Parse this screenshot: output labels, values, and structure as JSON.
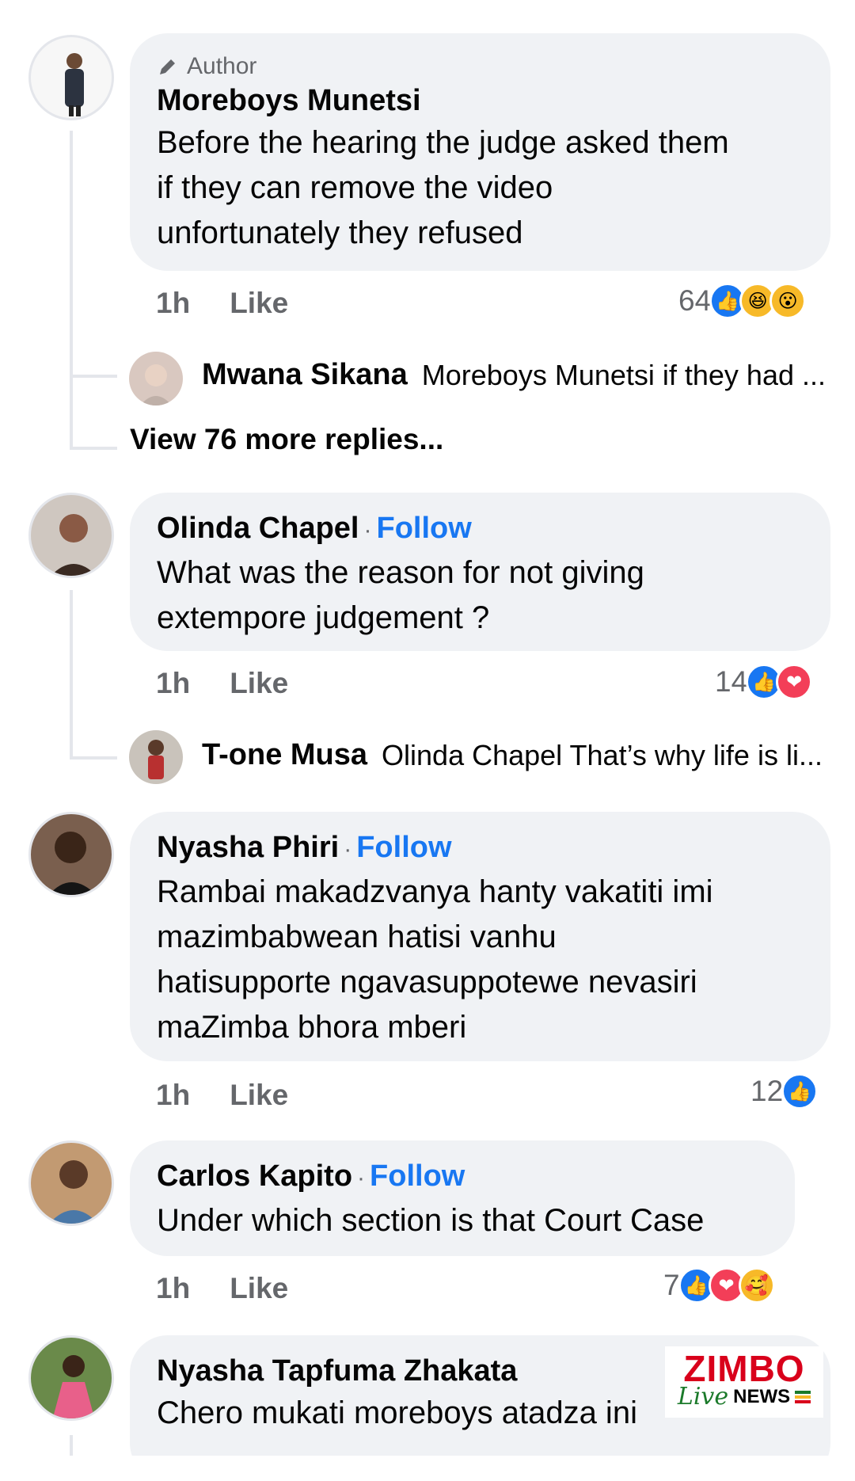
{
  "comments": [
    {
      "author_tag": "Author",
      "name": "Moreboys Munetsi",
      "text_lines": [
        "Before the hearing the judge asked them",
        "if they can remove the video",
        "unfortunately they refused"
      ],
      "time": "1h",
      "like_label": "Like",
      "reaction_count": "64",
      "reactions": [
        "like-icon",
        "haha-icon",
        "wow-icon"
      ],
      "reply": {
        "name": "Mwana Sikana",
        "text": "Moreboys Munetsi if they had ..."
      },
      "view_more": "View 76 more replies..."
    },
    {
      "name": "Olinda Chapel",
      "follow_label": "Follow",
      "text_lines": [
        "What was the reason for not giving",
        "extempore judgement ?"
      ],
      "time": "1h",
      "like_label": "Like",
      "reaction_count": "14",
      "reactions": [
        "like-icon",
        "love-icon"
      ],
      "reply": {
        "name": "T-one Musa",
        "text": "Olinda Chapel That’s why life is li..."
      }
    },
    {
      "name": "Nyasha Phiri",
      "follow_label": "Follow",
      "text_lines": [
        "Rambai makadzvanya hanty vakatiti imi",
        "mazimbabwean hatisi vanhu",
        "hatisupporte ngavasuppotewe nevasiri",
        "maZimba bhora mberi"
      ],
      "time": "1h",
      "like_label": "Like",
      "reaction_count": "12",
      "reactions": [
        "like-icon"
      ]
    },
    {
      "name": "Carlos Kapito",
      "follow_label": "Follow",
      "text_lines": [
        "Under which section is that Court Case"
      ],
      "time": "1h",
      "like_label": "Like",
      "reaction_count": "7",
      "reactions": [
        "like-icon",
        "love-icon",
        "care-icon"
      ]
    },
    {
      "name": "Nyasha Tapfuma Zhakata",
      "text_lines": [
        "Chero mukati moreboys atadza ini"
      ]
    }
  ],
  "watermark": {
    "top": "ZIMBO",
    "live": "Live",
    "news": "NEWS"
  },
  "colors": {
    "accent": "#1877f2",
    "bubble": "#f0f2f5",
    "secondary_text": "#65676b"
  }
}
